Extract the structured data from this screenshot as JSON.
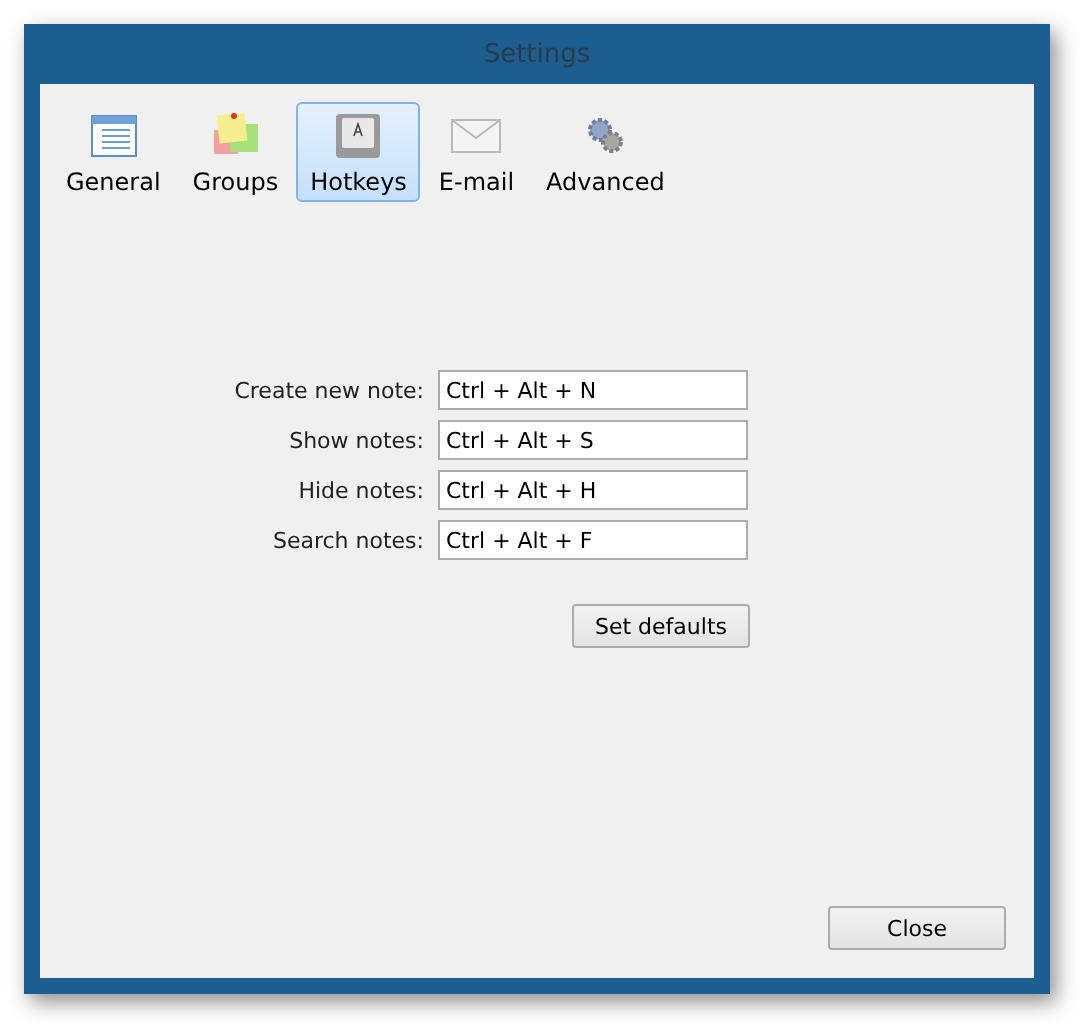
{
  "window": {
    "title": "Settings"
  },
  "tabs": [
    {
      "label": "General",
      "kind": "general",
      "selected": false
    },
    {
      "label": "Groups",
      "kind": "groups",
      "selected": false
    },
    {
      "label": "Hotkeys",
      "kind": "hotkeys",
      "selected": true
    },
    {
      "label": "E-mail",
      "kind": "email",
      "selected": false
    },
    {
      "label": "Advanced",
      "kind": "advanced",
      "selected": false
    }
  ],
  "hotkeys": [
    {
      "label": "Create new note:",
      "value": "Ctrl + Alt + N"
    },
    {
      "label": "Show notes:",
      "value": "Ctrl + Alt + S"
    },
    {
      "label": "Hide notes:",
      "value": "Ctrl + Alt + H"
    },
    {
      "label": "Search notes:",
      "value": "Ctrl + Alt + F"
    }
  ],
  "set_defaults_button": "Set defaults",
  "close_button": "Close"
}
